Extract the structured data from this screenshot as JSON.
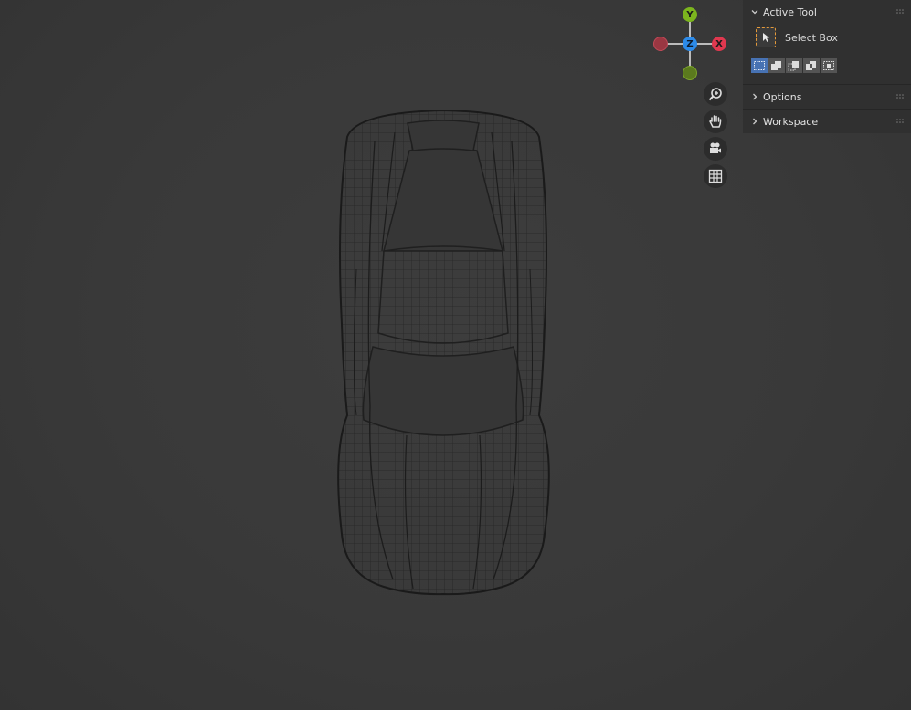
{
  "gizmo": {
    "y_label": "Y",
    "z_label": "Z",
    "x_label": "X",
    "colors": {
      "x": "#e0384f",
      "y": "#7cb51e",
      "z": "#2c8ae8",
      "neg_x": "#9a3742",
      "neg_y": "#5b7a1e"
    }
  },
  "nav_buttons": [
    "zoom-icon",
    "hand-pan-icon",
    "camera-icon",
    "grid-ortho-icon"
  ],
  "panel": {
    "active_tool": {
      "title": "Active Tool",
      "tool_label": "Select Box",
      "selection_modes": [
        "set",
        "extend",
        "subtract",
        "difference",
        "intersect"
      ],
      "active_mode_index": 0
    },
    "options": {
      "title": "Options"
    },
    "workspace": {
      "title": "Workspace"
    }
  }
}
